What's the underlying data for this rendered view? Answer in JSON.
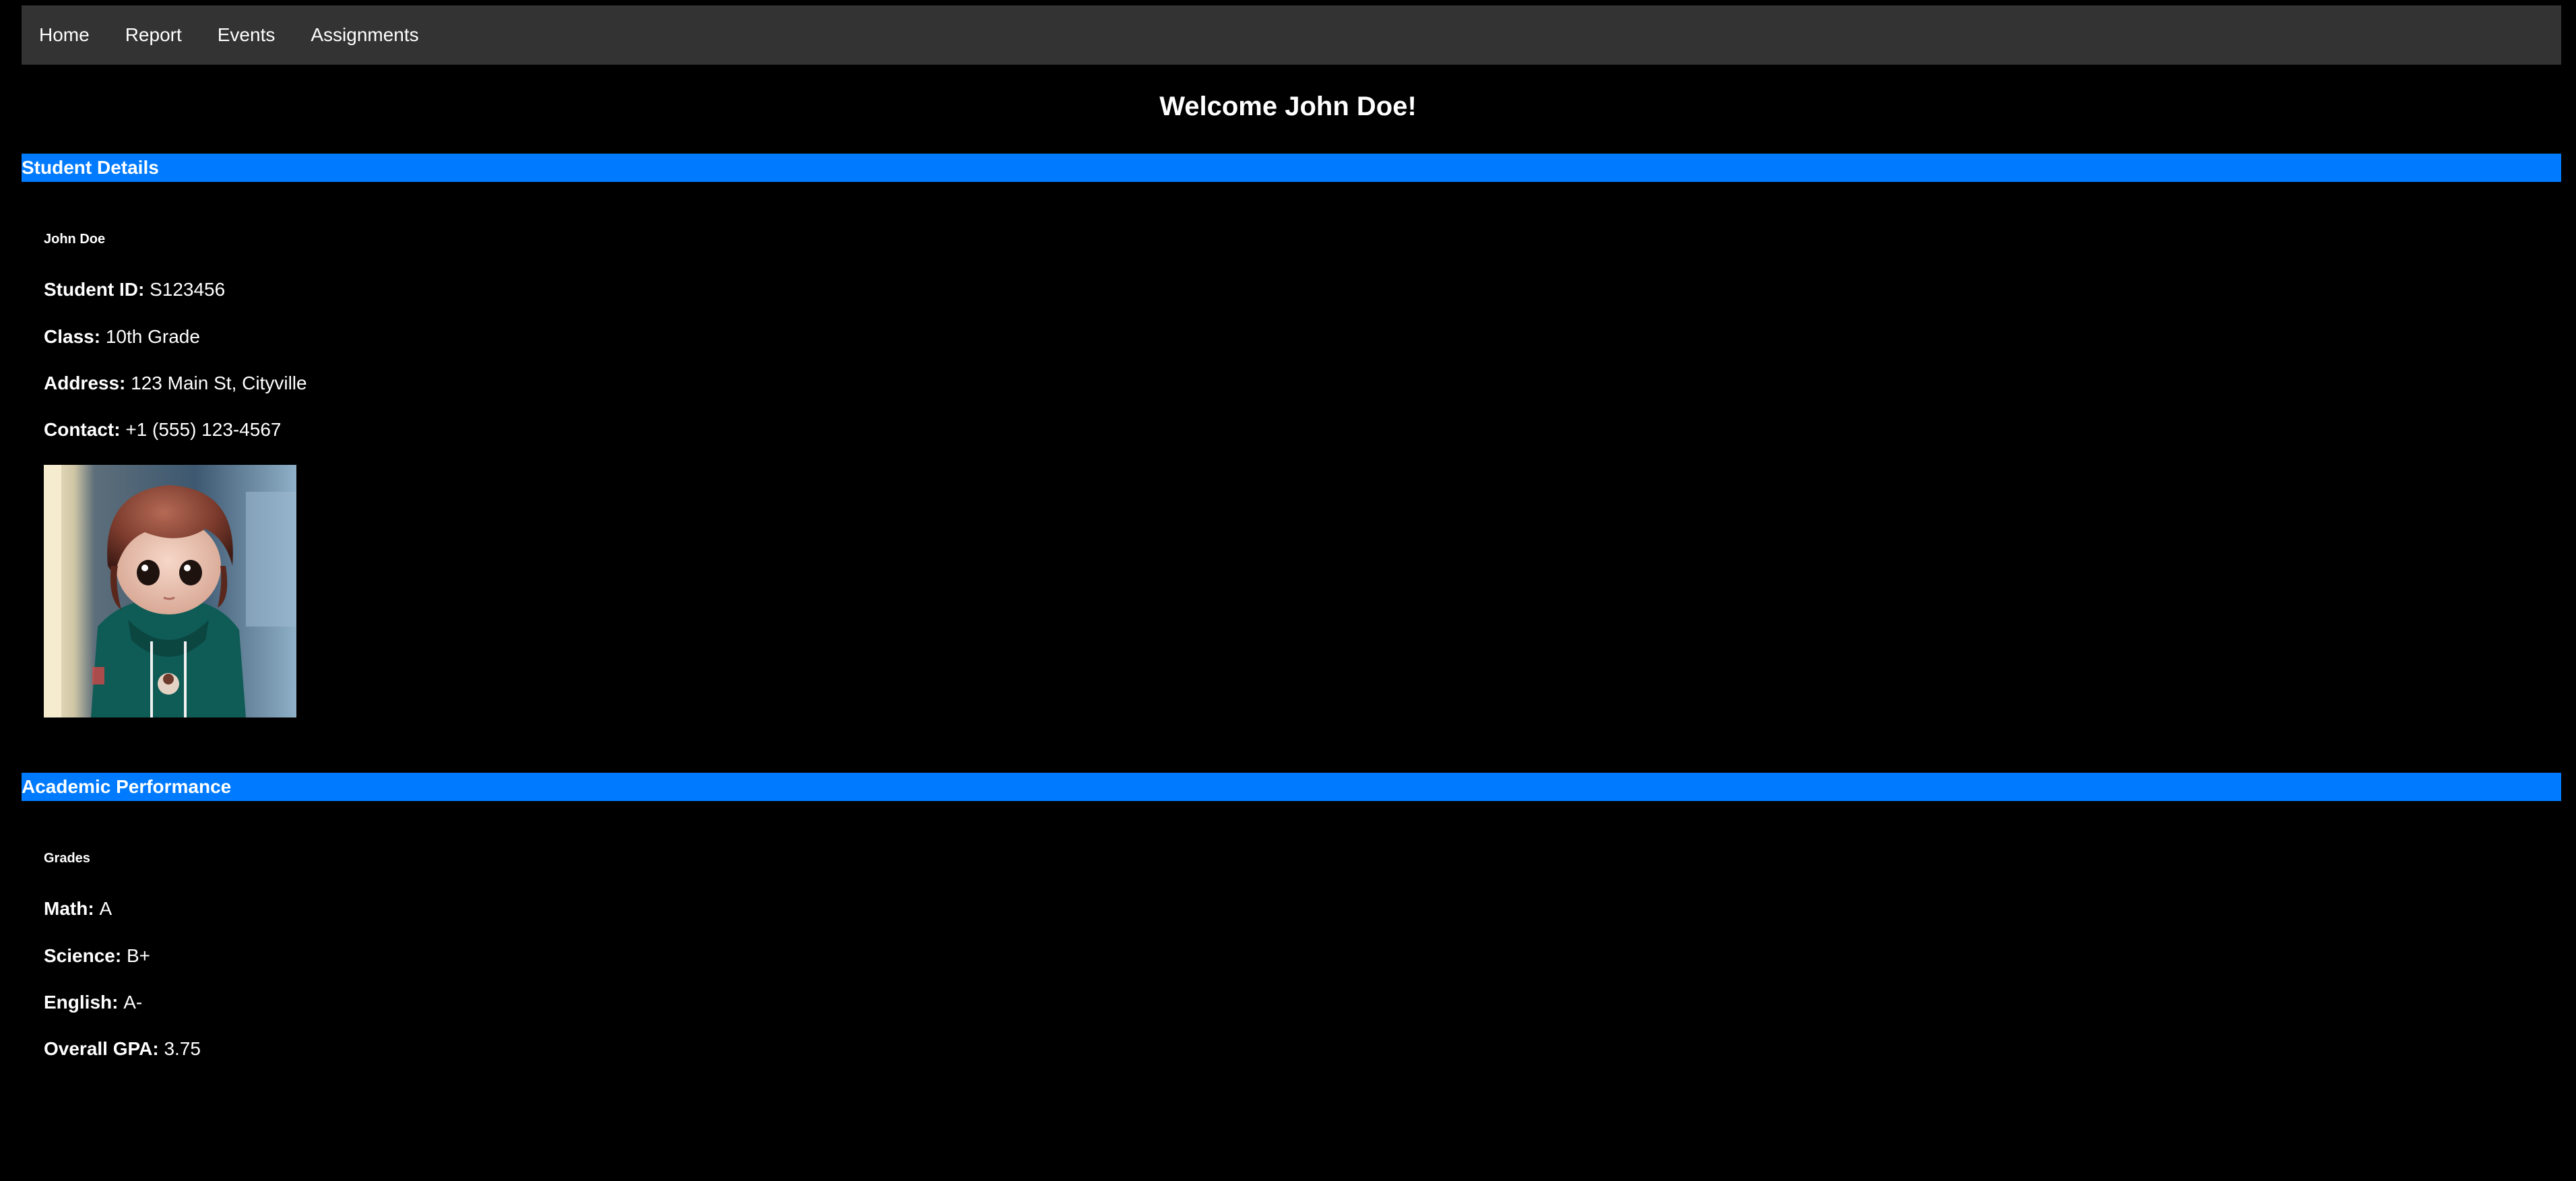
{
  "nav": {
    "items": [
      {
        "label": "Home"
      },
      {
        "label": "Report"
      },
      {
        "label": "Events"
      },
      {
        "label": "Assignments"
      }
    ]
  },
  "welcome": "Welcome John Doe!",
  "student_details": {
    "header": "Student Details",
    "name": "John Doe",
    "fields": [
      {
        "label": "Student ID:",
        "value": "S123456"
      },
      {
        "label": "Class:",
        "value": "10th Grade"
      },
      {
        "label": "Address:",
        "value": "123 Main St, Cityville"
      },
      {
        "label": "Contact:",
        "value": "+1 (555) 123-4567"
      }
    ],
    "photo_icon": "student-photo"
  },
  "academic": {
    "header": "Academic Performance",
    "title": "Grades",
    "fields": [
      {
        "label": "Math:",
        "value": "A"
      },
      {
        "label": "Science:",
        "value": "B+"
      },
      {
        "label": "English:",
        "value": "A-"
      },
      {
        "label": "Overall GPA:",
        "value": "3.75"
      }
    ]
  },
  "colors": {
    "background": "#000000",
    "navbar": "#333333",
    "section_header": "#007bff",
    "text": "#ffffff"
  }
}
